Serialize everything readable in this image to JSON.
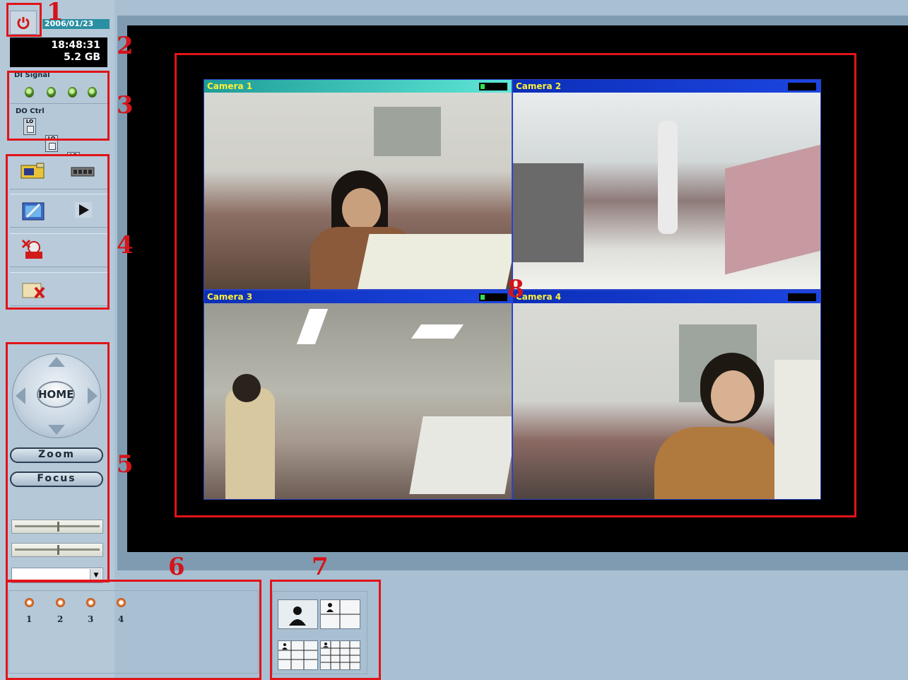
{
  "status": {
    "date": "2006/01/23",
    "time": "18:48:31",
    "disk": "5.2 GB"
  },
  "io": {
    "di_label": "DI Signal",
    "do_label": "DO Ctrl",
    "do_switch_label": "LO"
  },
  "ptz": {
    "home_label": "HOME",
    "zoom_label": "Zoom",
    "focus_label": "Focus"
  },
  "cameras": [
    {
      "title": "Camera 1",
      "active": true
    },
    {
      "title": "Camera 2",
      "active": false
    },
    {
      "title": "Camera 3",
      "active": false
    },
    {
      "title": "Camera 4",
      "active": false
    }
  ],
  "inputs": [
    "1",
    "2",
    "3",
    "4"
  ],
  "callouts": [
    "1",
    "2",
    "3",
    "4",
    "5",
    "6",
    "7",
    "8"
  ],
  "colors": {
    "highlight": "#e0141a",
    "active_title": "#1d9c96",
    "inactive_title": "#0c2fb8",
    "title_text": "#ffef3a"
  },
  "icons": [
    "power-icon",
    "snapshot-icon",
    "video-card-icon",
    "edit-icon",
    "play-icon",
    "stop-record-icon",
    "delete-icon",
    "single-view-icon",
    "quad-view-icon",
    "nine-view-icon",
    "sixteen-view-icon"
  ]
}
